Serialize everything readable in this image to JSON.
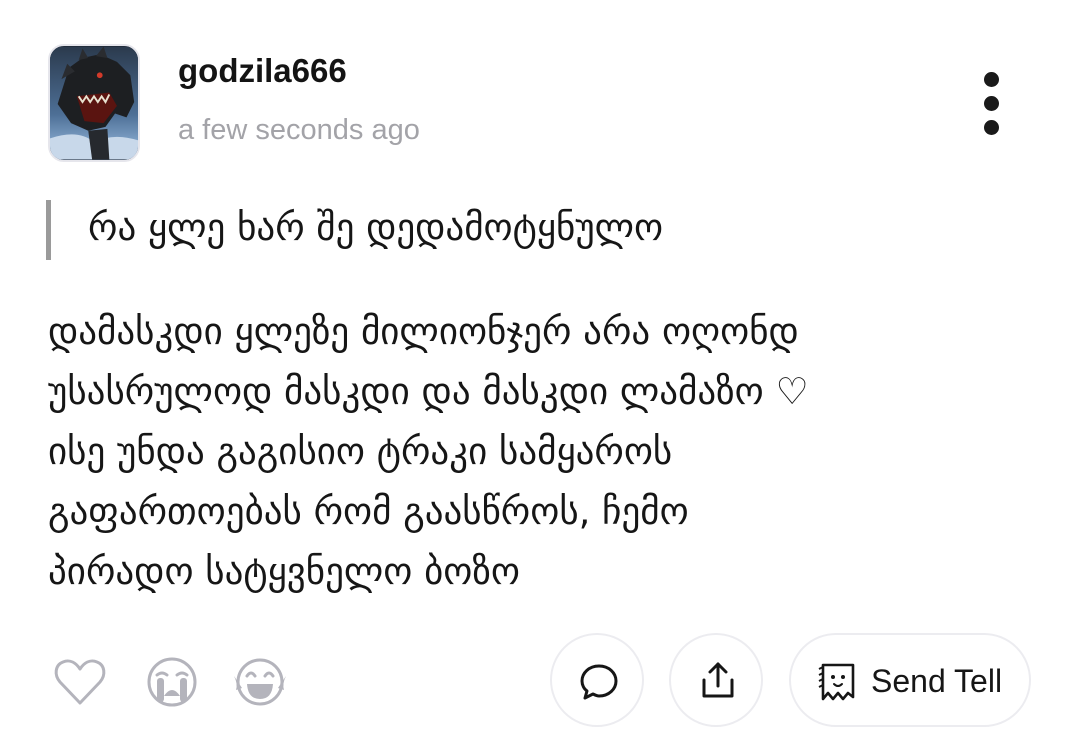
{
  "post": {
    "author": "godzila666",
    "timestamp": "a few seconds ago",
    "avatar_icon": "godzilla-avatar",
    "quote": "რა ყლე ხარ შე დედამოტყნულო",
    "body_lines": [
      "დამასკდი ყლეზე მილიონჯერ არა ოღონდ",
      "უსასრულოდ მასკდი და მასკდი ლამაზო ♡",
      "ისე უნდა გაგისიო ტრაკი სამყაროს",
      "გაფართოებას რომ გაასწროს, ჩემო",
      "პირადო სატყვნელო ბოზო"
    ]
  },
  "actions": {
    "reactions": [
      "heart-icon",
      "crying-face-icon",
      "laughing-face-icon"
    ],
    "comment_icon": "comment-bubble-icon",
    "share_icon": "share-upload-icon",
    "send_tell_icon": "ghost-note-icon",
    "send_tell_label": "Send Tell"
  },
  "colors": {
    "text": "#161616",
    "muted": "#a3a3a8",
    "icon_gray": "#b4b4bc",
    "border": "#ececf0"
  }
}
